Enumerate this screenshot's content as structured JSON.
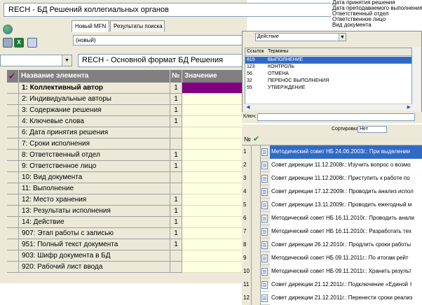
{
  "title_field": "RECH - БД Решений коллегиальных органов",
  "tabs": [
    {
      "label": "Новый MFN"
    },
    {
      "label": "Результаты поиска"
    }
  ],
  "record_select": "(новый)",
  "format_field": "RECH - Основной формат БД Решения",
  "grid": {
    "col_name": "Название элемента",
    "col_num": "№",
    "col_value": "Значение",
    "rows": [
      {
        "name": "1: Коллективный автор",
        "num": "1"
      },
      {
        "name": "2: Индивидуальные авторы",
        "num": "1"
      },
      {
        "name": "3: Содержание решения",
        "num": "1"
      },
      {
        "name": "4: Ключевые слова",
        "num": "1"
      },
      {
        "name": "6: Дата принятия решения",
        "num": ""
      },
      {
        "name": "7: Сроки исполнения",
        "num": ""
      },
      {
        "name": "8: Ответственный отдел",
        "num": "1"
      },
      {
        "name": "9: Ответственное лицо",
        "num": "1"
      },
      {
        "name": "10: Вид документа",
        "num": ""
      },
      {
        "name": "11: Выполнение",
        "num": ""
      },
      {
        "name": "12: Место хранения",
        "num": "1"
      },
      {
        "name": "13: Результаты исполнения",
        "num": "1"
      },
      {
        "name": "14: Действие",
        "num": "1"
      },
      {
        "name": "907: Этап работы с записью",
        "num": "1"
      },
      {
        "name": "951: Полный текст документа",
        "num": "1"
      },
      {
        "name": "903: Шифр документа в БД",
        "num": ""
      },
      {
        "name": "920: Рабочий лист ввода",
        "num": ""
      }
    ]
  },
  "context_menu": [
    "Дата принятия решения",
    "Дата преподаваемого выполнения",
    "Ответственный отдел",
    "Ответственное лицо",
    "Вид документа"
  ],
  "terms": {
    "select_value": "Действие",
    "col_code": "Ссылок",
    "col_term": "Термины",
    "rows": [
      {
        "code": "815",
        "term": "ВЫПОЛНЕНИЕ",
        "selected": true
      },
      {
        "code": "123",
        "term": "КОНТРОЛЬ",
        "selected": false
      },
      {
        "code": "56",
        "term": "ОТМЕНА",
        "selected": false
      },
      {
        "code": "32",
        "term": "ПЕРЕНОС ВЫПОЛНЕНИЯ",
        "selected": false
      },
      {
        "code": "55",
        "term": "УТВЕРЖДЕНИЕ",
        "selected": false
      }
    ]
  },
  "key_label": "Ключ:",
  "docs": {
    "sort_label": "Сортировка",
    "sort_value": "Нет",
    "col_num": "№",
    "rows": [
      {
        "num": "1",
        "text": "Методический совет НБ 24.06.2003г.: При выделении",
        "selected": true
      },
      {
        "num": "2",
        "text": "Совет дирекции 11.12.2008г.: Изучить вопрос о возмо",
        "selected": false
      },
      {
        "num": "3",
        "text": "Совет дирекции 11.12.2008г.: Приступить к работе по",
        "selected": false
      },
      {
        "num": "4",
        "text": "Совет дирекции 17.12.2009г.: Проводить анализ испол",
        "selected": false
      },
      {
        "num": "5",
        "text": "Совет дирекции 13.11.2009г.: Проводить ежегодный м",
        "selected": false
      },
      {
        "num": "6",
        "text": "Методический совет НБ 16.11.2010г.: Проводить анали",
        "selected": false
      },
      {
        "num": "7",
        "text": "Методический совет НБ 16.11.2010г.: Разработать тех",
        "selected": false
      },
      {
        "num": "8",
        "text": "Совет дирекции 26.12.2010г.: Продлить сроки работы",
        "selected": false
      },
      {
        "num": "9",
        "text": "Методический совет НБ 09.11.2011г.: По итогам рейт",
        "selected": false
      },
      {
        "num": "10",
        "text": "Методический совет НБ 09.11.2011г.: Хранить результ",
        "selected": false
      },
      {
        "num": "11",
        "text": "Совет дирекции 21.12.2011г.: Подключение «Единой т",
        "selected": false
      },
      {
        "num": "12",
        "text": "Совет дирекции 21.12.2011г.: Перенести сроки реализ",
        "selected": false
      }
    ]
  },
  "colors": {
    "selection": "#316ac5",
    "value_highlight": "#800080",
    "value_bg": "#ffffe1",
    "header_bg": "#808080",
    "check_mark": "#800080"
  }
}
